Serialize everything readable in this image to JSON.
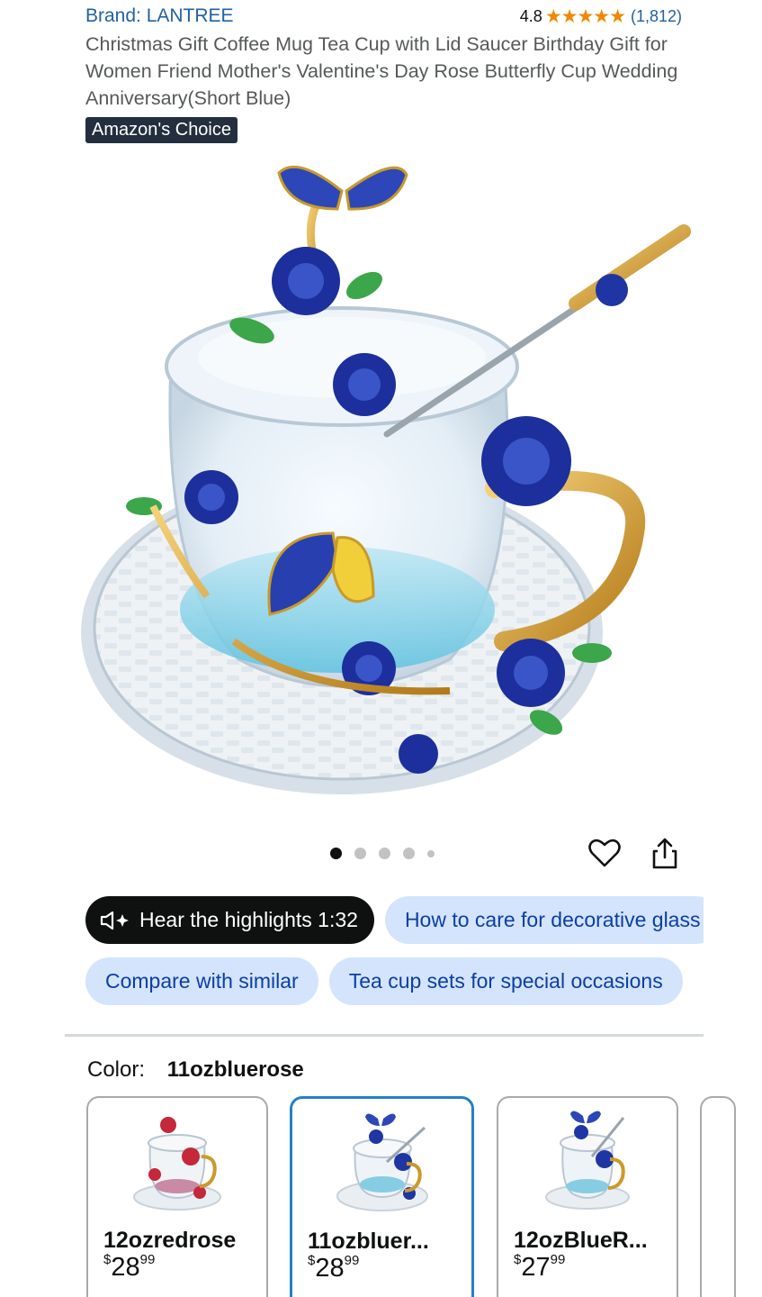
{
  "product": {
    "brand": "Brand: LANTREE",
    "rating": "4.8",
    "stars": "★★★★★",
    "rating_count": "(1,812)",
    "title": "Christmas Gift Coffee Mug Tea Cup with Lid Saucer Birthday Gift for Women Friend Mother's Valentine's Day Rose Butterfly Cup Wedding Anniversary(Short Blue)",
    "badge": "Amazon's Choice"
  },
  "gallery": {
    "image_count": 5,
    "active_index": 0,
    "icons": [
      "heart-icon",
      "share-icon"
    ]
  },
  "chips": {
    "row1": [
      {
        "label": "Hear the highlights 1:32",
        "style": "dark",
        "icon": "speaker-sparkle-icon"
      },
      {
        "label": "How to care for decorative glass",
        "style": "light"
      }
    ],
    "row2": [
      {
        "label": "Compare with similar",
        "style": "light"
      },
      {
        "label": "Tea cup sets for special occasions",
        "style": "light"
      }
    ]
  },
  "color": {
    "label": "Color:",
    "selected": "11ozbluerose",
    "options": [
      {
        "name": "12ozredrose",
        "price_dollars": "28",
        "price_cents": "99",
        "currency": "$",
        "selected": false
      },
      {
        "name": "11ozbluer...",
        "price_dollars": "28",
        "price_cents": "99",
        "currency": "$",
        "selected": true
      },
      {
        "name": "12ozBlueR...",
        "price_dollars": "27",
        "price_cents": "99",
        "currency": "$",
        "selected": false
      }
    ]
  },
  "colors": {
    "link": "#2162a1",
    "star": "#f08804",
    "badge_bg": "#232f3e",
    "chip_bg": "#d4e4fc",
    "chip_text": "#0b3fa6",
    "selected_border": "#2380c7"
  }
}
